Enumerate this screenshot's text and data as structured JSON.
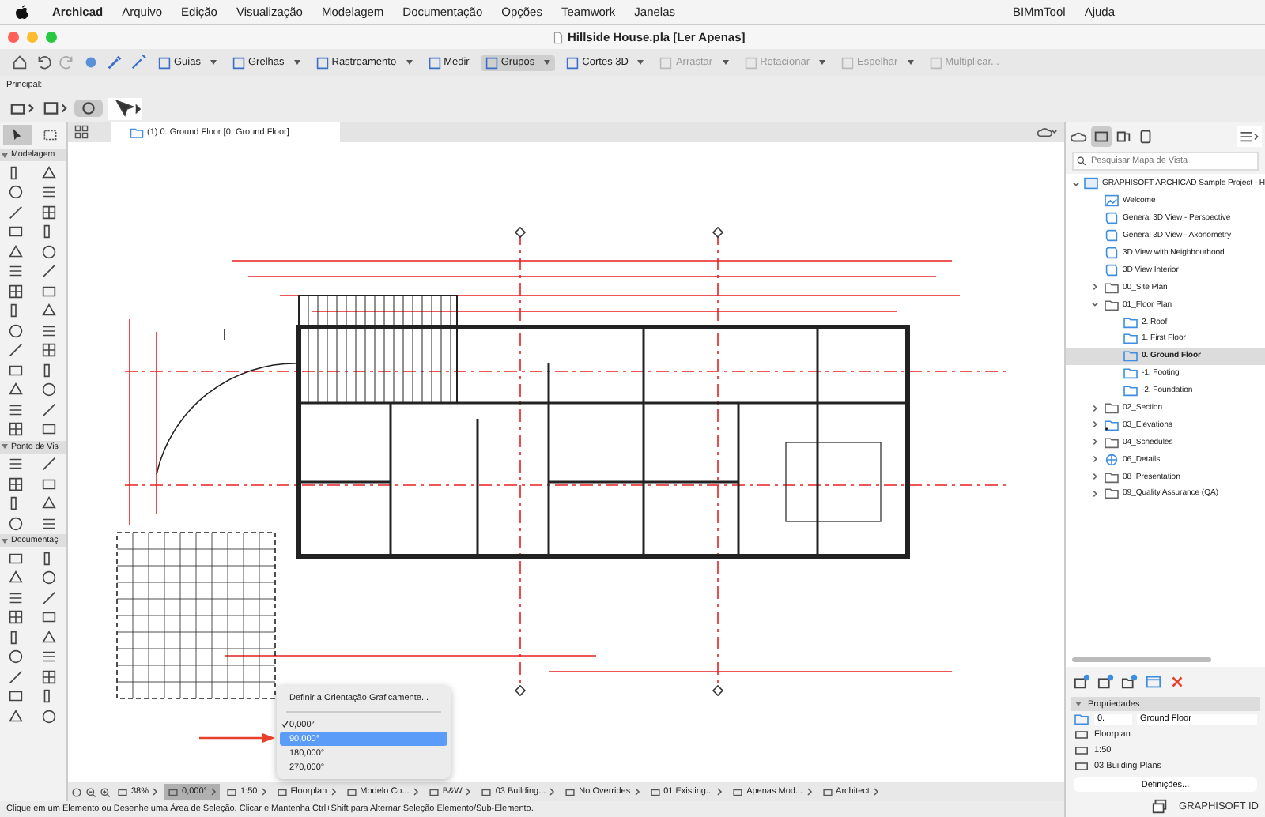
{
  "menu_bar": {
    "app": "Archicad",
    "items": [
      "Arquivo",
      "Edição",
      "Visualização",
      "Modelagem",
      "Documentação",
      "Opções",
      "Teamwork",
      "Janelas",
      "BIMmTool",
      "Ajuda"
    ]
  },
  "window": {
    "title": "Hillside House.pla [Ler Apenas]"
  },
  "toolbar": [
    {
      "label": "Guias",
      "dropdown": true,
      "selected": false,
      "disabled": false
    },
    {
      "label": "Grelhas",
      "dropdown": true,
      "selected": false,
      "disabled": false
    },
    {
      "label": "Rastreamento",
      "dropdown": true,
      "selected": false,
      "disabled": false
    },
    {
      "label": "Medir",
      "dropdown": false,
      "selected": false,
      "disabled": false
    },
    {
      "label": "Grupos",
      "dropdown": true,
      "selected": true,
      "disabled": false
    },
    {
      "label": "Cortes 3D",
      "dropdown": true,
      "selected": false,
      "disabled": false
    },
    {
      "label": "Arrastar",
      "dropdown": true,
      "selected": false,
      "disabled": true
    },
    {
      "label": "Rotacionar",
      "dropdown": true,
      "selected": false,
      "disabled": true
    },
    {
      "label": "Espelhar",
      "dropdown": true,
      "selected": false,
      "disabled": true
    },
    {
      "label": "Multiplicar...",
      "dropdown": false,
      "selected": false,
      "disabled": true
    }
  ],
  "principal_label": "Principal:",
  "toolbox": {
    "sections": [
      {
        "title": "Modelagem",
        "expanded": true
      },
      {
        "title": "Ponto de Vis",
        "expanded": true
      },
      {
        "title": "Documentaç",
        "expanded": true
      }
    ]
  },
  "tab": {
    "label": "(1) 0. Ground Floor [0. Ground Floor]"
  },
  "navigator": {
    "search": {
      "placeholder": "Pesquisar Mapa de Vista"
    },
    "tree": [
      {
        "label": "GRAPHISOFT ARCHICAD Sample Project - H",
        "kind": "project",
        "expanded": true,
        "selected": false,
        "children": [
          {
            "label": "Welcome",
            "kind": "image",
            "selected": false
          },
          {
            "label": "General 3D View - Perspective",
            "kind": "view3d",
            "selected": false
          },
          {
            "label": "General 3D View - Axonometry",
            "kind": "view3d",
            "selected": false
          },
          {
            "label": "3D View with Neighbourhood",
            "kind": "view3d",
            "selected": false
          },
          {
            "label": "3D View Interior",
            "kind": "view3d",
            "selected": false
          },
          {
            "label": "00_Site Plan",
            "kind": "folder",
            "expanded": false,
            "selected": false
          },
          {
            "label": "01_Floor Plan",
            "kind": "folder",
            "expanded": true,
            "selected": false,
            "children": [
              {
                "label": "2. Roof",
                "kind": "story",
                "selected": false
              },
              {
                "label": "1. First Floor",
                "kind": "story",
                "selected": false
              },
              {
                "label": "0. Ground Floor",
                "kind": "story",
                "selected": true
              },
              {
                "label": "-1. Footing",
                "kind": "story",
                "selected": false
              },
              {
                "label": "-2. Foundation",
                "kind": "story",
                "selected": false
              }
            ]
          },
          {
            "label": "02_Section",
            "kind": "folder",
            "expanded": false,
            "selected": false
          },
          {
            "label": "03_Elevations",
            "kind": "elevation",
            "expanded": false,
            "selected": false
          },
          {
            "label": "04_Schedules",
            "kind": "folder",
            "expanded": false,
            "selected": false
          },
          {
            "label": "06_Details",
            "kind": "globe",
            "expanded": false,
            "selected": false
          },
          {
            "label": "08_Presentation",
            "kind": "folder",
            "expanded": false,
            "selected": false
          },
          {
            "label": "09_Quality Assurance (QA)",
            "kind": "folder",
            "expanded": false,
            "selected": false
          }
        ]
      }
    ]
  },
  "properties": {
    "title": "Propriedades",
    "expanded": true,
    "id_value": "0.",
    "name_value": "Ground Floor",
    "rows": [
      "Floorplan",
      "1:50",
      "03 Building Plans"
    ],
    "button": "Definições...",
    "footer": "GRAPHISOFT ID"
  },
  "bottom_bar": [
    {
      "label": "38%",
      "selected": false
    },
    {
      "label": "0,000°",
      "selected": true
    },
    {
      "label": "1:50",
      "selected": false
    },
    {
      "label": "Floorplan",
      "selected": false
    },
    {
      "label": "Modelo Co...",
      "selected": false
    },
    {
      "label": "B&W",
      "selected": false
    },
    {
      "label": "03 Building...",
      "selected": false
    },
    {
      "label": "No Overrides",
      "selected": false
    },
    {
      "label": "01 Existing...",
      "selected": false
    },
    {
      "label": "Apenas Mod...",
      "selected": false
    },
    {
      "label": "Architect",
      "selected": false
    }
  ],
  "orientation_menu": {
    "header": "Definir a Orientação Graficamente...",
    "options": [
      {
        "label": "0,000°",
        "checked": true,
        "selected": false
      },
      {
        "label": "90,000°",
        "checked": false,
        "selected": true
      },
      {
        "label": "180,000°",
        "checked": false,
        "selected": false
      },
      {
        "label": "270,000°",
        "checked": false,
        "selected": false
      }
    ]
  },
  "status_text": "Clique em um Elemento ou Desenhe uma Área de Seleção. Clicar e Mantenha Ctrl+Shift para Alternar Seleção Elemento/Sub-Elemento."
}
